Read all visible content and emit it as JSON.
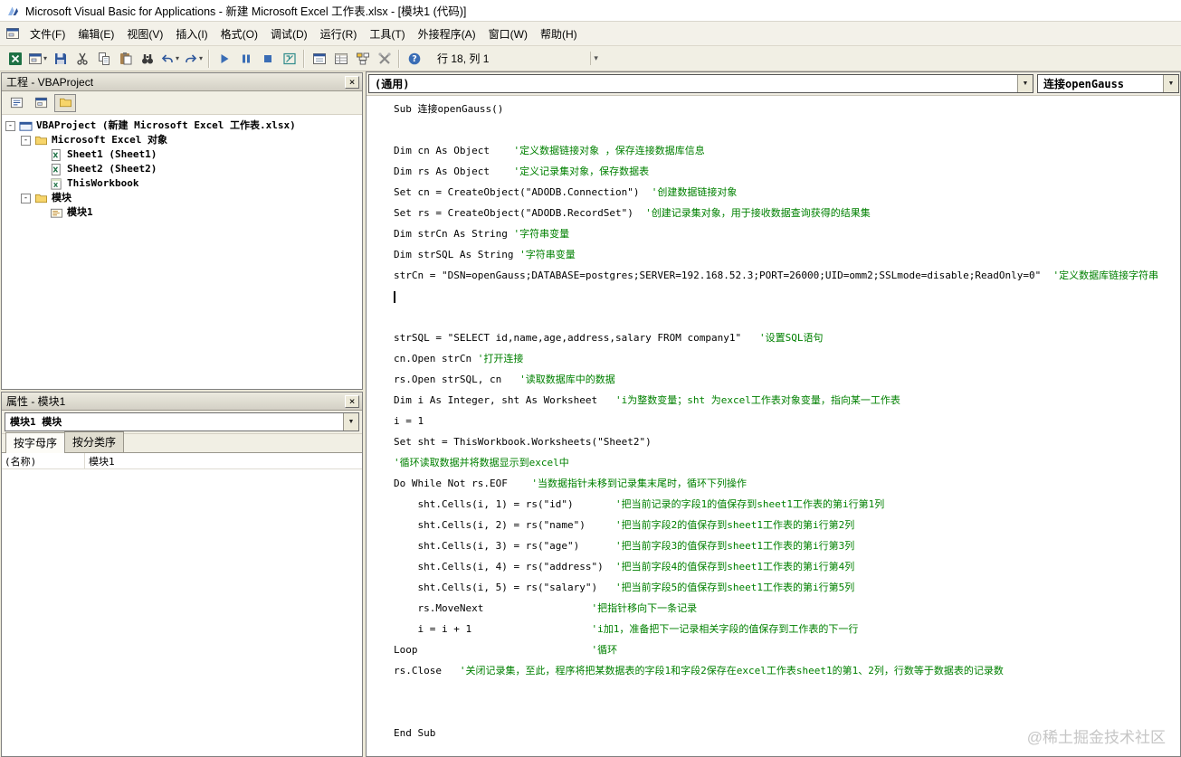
{
  "window": {
    "title": "Microsoft Visual Basic for Applications - 新建 Microsoft Excel 工作表.xlsx - [模块1 (代码)]"
  },
  "glyphs": {
    "close": "×",
    "dropdown": "▼",
    "chevron": "▾",
    "collapse": "-"
  },
  "menu_bar": {
    "items": [
      {
        "id": "file",
        "label": "文件(F)"
      },
      {
        "id": "edit",
        "label": "编辑(E)"
      },
      {
        "id": "view",
        "label": "视图(V)"
      },
      {
        "id": "insert",
        "label": "插入(I)"
      },
      {
        "id": "format",
        "label": "格式(O)"
      },
      {
        "id": "debug",
        "label": "调试(D)"
      },
      {
        "id": "run",
        "label": "运行(R)"
      },
      {
        "id": "tools",
        "label": "工具(T)"
      },
      {
        "id": "addins",
        "label": "外接程序(A)"
      },
      {
        "id": "window",
        "label": "窗口(W)"
      },
      {
        "id": "help",
        "label": "帮助(H)"
      }
    ]
  },
  "toolbar": {
    "icons": [
      {
        "id": "view-excel"
      },
      {
        "id": "insert-userform",
        "dropdown": true
      },
      {
        "id": "save"
      },
      {
        "id": "cut"
      },
      {
        "id": "copy"
      },
      {
        "id": "paste"
      },
      {
        "id": "find"
      },
      {
        "id": "undo",
        "dropdown": true
      },
      {
        "id": "redo",
        "dropdown": true
      },
      {
        "id": "sep"
      },
      {
        "id": "run"
      },
      {
        "id": "break"
      },
      {
        "id": "reset"
      },
      {
        "id": "design-mode"
      },
      {
        "id": "sep"
      },
      {
        "id": "project-explorer"
      },
      {
        "id": "properties-window"
      },
      {
        "id": "object-browser"
      },
      {
        "id": "toolbox"
      },
      {
        "id": "sep"
      },
      {
        "id": "help"
      }
    ],
    "position_label": "行 18, 列 1"
  },
  "project_panel": {
    "title": "工程 - VBAProject",
    "buttons": [
      {
        "id": "view-code",
        "icon": "view-code"
      },
      {
        "id": "view-object",
        "icon": "insert-userform"
      },
      {
        "id": "toggle-folders",
        "icon": "folder",
        "active": true
      }
    ],
    "tree": [
      {
        "id": "vbaproject-root",
        "label": "VBAProject (新建 Microsoft Excel 工作表.xlsx)",
        "level": 0,
        "expanded": true,
        "icon": "project",
        "bold": true
      },
      {
        "id": "excel-objects-folder",
        "label": "Microsoft Excel 对象",
        "level": 1,
        "expanded": true,
        "icon": "folder"
      },
      {
        "id": "sheet1",
        "label": "Sheet1 (Sheet1)",
        "level": 2,
        "icon": "sheet"
      },
      {
        "id": "sheet2",
        "label": "Sheet2 (Sheet2)",
        "level": 2,
        "icon": "sheet"
      },
      {
        "id": "thisworkbook",
        "label": "ThisWorkbook",
        "level": 2,
        "icon": "workbook"
      },
      {
        "id": "modules-folder",
        "label": "模块",
        "level": 1,
        "expanded": true,
        "icon": "folder"
      },
      {
        "id": "module1",
        "label": "模块1",
        "level": 2,
        "icon": "module"
      }
    ]
  },
  "properties_panel": {
    "title": "属性 - 模块1",
    "object_selector": "模块1 模块",
    "tabs": [
      "按字母序",
      "按分类序"
    ],
    "rows": [
      {
        "name": "(名称)",
        "value": "模块1"
      }
    ]
  },
  "code_panel": {
    "object_box": "(通用)",
    "procedure_box": "连接openGauss",
    "lines": [
      {
        "c": "Sub 连接openGauss()",
        "m": ""
      },
      {
        "c": "",
        "m": ""
      },
      {
        "c": "Dim cn As Object    ",
        "m": "'定义数据链接对象 ，保存连接数据库信息"
      },
      {
        "c": "Dim rs As Object    ",
        "m": "'定义记录集对象，保存数据表"
      },
      {
        "c": "Set cn = CreateObject(\"ADODB.Connection\")  ",
        "m": "'创建数据链接对象"
      },
      {
        "c": "Set rs = CreateObject(\"ADODB.RecordSet\")  ",
        "m": "'创建记录集对象，用于接收数据查询获得的结果集"
      },
      {
        "c": "Dim strCn As String ",
        "m": "'字符串变量"
      },
      {
        "c": "Dim strSQL As String ",
        "m": "'字符串变量"
      },
      {
        "c": "strCn = \"DSN=openGauss;DATABASE=postgres;SERVER=192.168.52.3;PORT=26000;UID=omm2;SSLmode=disable;ReadOnly=0\"  ",
        "m": "'定义数据库链接字符串"
      },
      {
        "c": "",
        "m": "",
        "caret": true
      },
      {
        "c": "",
        "m": ""
      },
      {
        "c": "strSQL = \"SELECT id,name,age,address,salary FROM company1\"   ",
        "m": "'设置SQL语句"
      },
      {
        "c": "cn.Open strCn ",
        "m": "'打开连接"
      },
      {
        "c": "rs.Open strSQL, cn   ",
        "m": "'读取数据库中的数据"
      },
      {
        "c": "Dim i As Integer, sht As Worksheet   ",
        "m": "'i为整数变量；sht 为excel工作表对象变量，指向某一工作表"
      },
      {
        "c": "i = 1",
        "m": ""
      },
      {
        "c": "Set sht = ThisWorkbook.Worksheets(\"Sheet2\")",
        "m": ""
      },
      {
        "c": "",
        "m": "'循环读取数据并将数据显示到excel中"
      },
      {
        "c": "Do While Not rs.EOF    ",
        "m": "'当数据指针未移到记录集末尾时，循环下列操作"
      },
      {
        "c": "    sht.Cells(i, 1) = rs(\"id\")       ",
        "m": "'把当前记录的字段1的值保存到sheet1工作表的第i行第1列"
      },
      {
        "c": "    sht.Cells(i, 2) = rs(\"name\")     ",
        "m": "'把当前字段2的值保存到sheet1工作表的第i行第2列"
      },
      {
        "c": "    sht.Cells(i, 3) = rs(\"age\")      ",
        "m": "'把当前字段3的值保存到sheet1工作表的第i行第3列"
      },
      {
        "c": "    sht.Cells(i, 4) = rs(\"address\")  ",
        "m": "'把当前字段4的值保存到sheet1工作表的第i行第4列"
      },
      {
        "c": "    sht.Cells(i, 5) = rs(\"salary\")   ",
        "m": "'把当前字段5的值保存到sheet1工作表的第i行第5列"
      },
      {
        "c": "    rs.MoveNext                  ",
        "m": "'把指针移向下一条记录"
      },
      {
        "c": "    i = i + 1                    ",
        "m": "'i加1，准备把下一记录相关字段的值保存到工作表的下一行"
      },
      {
        "c": "Loop                             ",
        "m": "'循环"
      },
      {
        "c": "rs.Close   ",
        "m": "'关闭记录集，至此，程序将把某数据表的字段1和字段2保存在excel工作表sheet1的第1、2列，行数等于数据表的记录数"
      },
      {
        "c": "",
        "m": ""
      },
      {
        "c": "",
        "m": ""
      },
      {
        "c": "End Sub",
        "m": ""
      }
    ]
  },
  "watermark": "@稀土掘金技术社区"
}
